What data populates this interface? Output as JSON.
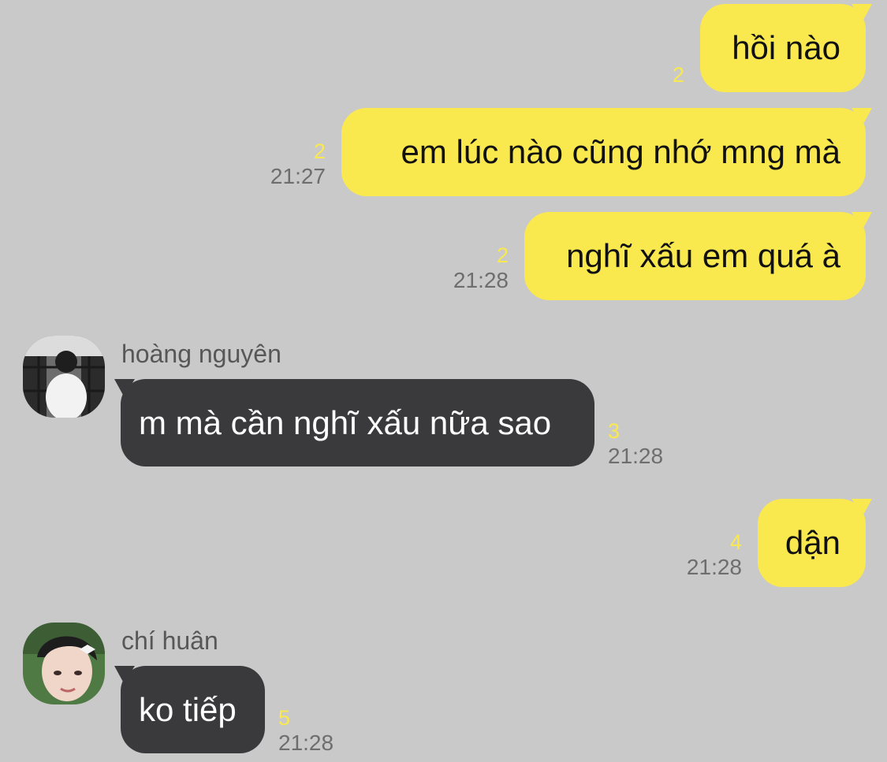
{
  "messages": [
    {
      "text": "hồi nào",
      "unread": "2"
    },
    {
      "text": "em lúc nào cũng nhớ mng mà",
      "unread": "2",
      "time": "21:27"
    },
    {
      "text": "nghĩ xấu em quá à",
      "unread": "2",
      "time": "21:28"
    },
    {
      "sender": "hoàng nguyên",
      "text": "m mà cần nghĩ xấu nữa sao",
      "unread": "3",
      "time": "21:28"
    },
    {
      "text": "dận",
      "unread": "4",
      "time": "21:28"
    },
    {
      "sender": "chí huân",
      "text": "ko tiếp",
      "unread": "5",
      "time": "21:28"
    }
  ],
  "colors": {
    "background": "#c9c9c9",
    "outgoing_bubble": "#fae84f",
    "incoming_bubble": "#3a3a3c",
    "unread_count": "#fae84f",
    "timestamp": "#6e6e6e"
  },
  "avatars": [
    {
      "icon": "avatar-hoang-nguyen",
      "description": "profile photo"
    },
    {
      "icon": "avatar-chi-huan",
      "description": "profile photo"
    }
  ]
}
